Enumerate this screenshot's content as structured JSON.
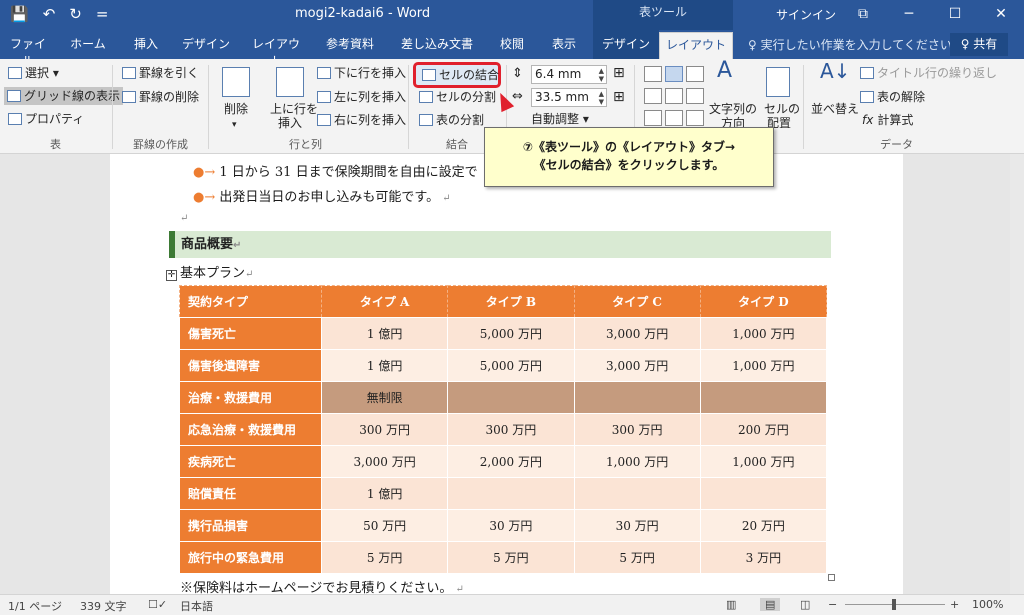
{
  "titlebar": {
    "doc_title": "mogi2-kadai6  -  Word",
    "context_tool": "表ツール",
    "signin": "サインイン",
    "qat": [
      "💾",
      "↶",
      "↻",
      "="
    ],
    "window_controls": [
      "⧉",
      "─",
      "☐",
      "✕"
    ]
  },
  "tabs": [
    "ファイル",
    "ホーム",
    "挿入",
    "デザイン",
    "レイアウト",
    "参考資料",
    "差し込み文書",
    "校閲",
    "表示",
    "デザイン",
    "レイアウト"
  ],
  "tellme": "♀ 実行したい作業を入力してください",
  "share": "♀ 共有",
  "ribbon": {
    "table": {
      "select": "選択 ▾",
      "gridlines": "グリッド線の表示",
      "properties": "プロパティ",
      "group": "表"
    },
    "draw": {
      "draw_border": "罫線を引く",
      "erase_border": "罫線の削除",
      "group": "罫線の作成"
    },
    "rows_cols": {
      "delete": "削除",
      "insert_above_1": "上に行を",
      "insert_above_2": "挿入",
      "insert_below": "下に行を挿入",
      "insert_left": "左に列を挿入",
      "insert_right": "右に列を挿入",
      "group": "行と列"
    },
    "merge": {
      "merge_cells": "セルの結合",
      "split_cells": "セルの分割",
      "split_table": "表の分割",
      "group": "結合"
    },
    "size": {
      "height": "6.4 mm",
      "width": "33.5 mm",
      "autofit": "自動調整 ▾"
    },
    "align": {
      "direction_1": "文字列の",
      "direction_2": "方向",
      "margins_1": "セルの",
      "margins_2": "配置"
    },
    "data": {
      "sort": "並べ替え",
      "repeat_header": "タイトル行の繰り返し",
      "convert": "表の解除",
      "formula": "計算式",
      "group": "データ"
    }
  },
  "callout": {
    "line1": "⑦《表ツール》の《レイアウト》タブ→",
    "line2": "《セルの結合》をクリックします。"
  },
  "document": {
    "bullet1": "1 日から 31 日まで保険期間を自由に設定で",
    "bullet2": "出発日当日のお申し込みも可能です。",
    "heading": "商品概要",
    "subheading": "基本プラン",
    "footnote": "※保険料はホームページでお見積りください。"
  },
  "table": {
    "headers": [
      "契約タイプ",
      "タイプ A",
      "タイプ B",
      "タイプ C",
      "タイプ D"
    ],
    "rows": [
      {
        "label": "傷害死亡",
        "values": [
          "1 億円",
          "5,000 万円",
          "3,000 万円",
          "1,000 万円"
        ]
      },
      {
        "label": "傷害後遺障害",
        "values": [
          "1 億円",
          "5,000 万円",
          "3,000 万円",
          "1,000 万円"
        ]
      },
      {
        "label": "治療・救援費用",
        "values": [
          "無制限",
          "",
          "",
          ""
        ]
      },
      {
        "label": "応急治療・救援費用",
        "values": [
          "300 万円",
          "300 万円",
          "300 万円",
          "200 万円"
        ]
      },
      {
        "label": "疾病死亡",
        "values": [
          "3,000 万円",
          "2,000 万円",
          "1,000 万円",
          "1,000 万円"
        ]
      },
      {
        "label": "賠償責任",
        "values": [
          "1 億円",
          "",
          "",
          ""
        ]
      },
      {
        "label": "携行品損害",
        "values": [
          "50 万円",
          "30 万円",
          "30 万円",
          "20 万円"
        ]
      },
      {
        "label": "旅行中の緊急費用",
        "values": [
          "5 万円",
          "5 万円",
          "5 万円",
          "3 万円"
        ]
      }
    ]
  },
  "statusbar": {
    "page": "1/1 ページ",
    "words": "339 文字",
    "lang": "日本語",
    "zoom": "100%"
  }
}
